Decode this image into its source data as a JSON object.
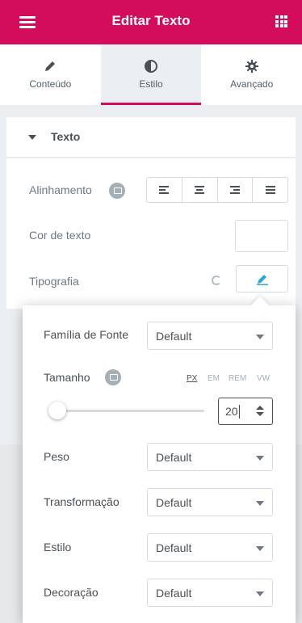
{
  "header": {
    "title": "Editar Texto",
    "menu_icon": "hamburger-icon",
    "apps_icon": "grid-icon"
  },
  "tabs": [
    {
      "label": "Conteúdo",
      "icon": "pencil-icon"
    },
    {
      "label": "Estilo",
      "icon": "half-circle-icon",
      "active": true
    },
    {
      "label": "Avançado",
      "icon": "gear-icon"
    }
  ],
  "section": {
    "title": "Texto"
  },
  "controls": {
    "alignment_label": "Alinhamento",
    "color_label": "Cor de texto",
    "typography_label": "Tipografia"
  },
  "typography": {
    "font_family_label": "Família de Fonte",
    "font_family_value": "Default",
    "size_label": "Tamanho",
    "units": [
      "PX",
      "EM",
      "REM",
      "VW"
    ],
    "selected_unit": "PX",
    "size_value": "20",
    "weight_label": "Peso",
    "weight_value": "Default",
    "transform_label": "Transformação",
    "transform_value": "Default",
    "style_label": "Estilo",
    "style_value": "Default",
    "decoration_label": "Decoração",
    "decoration_value": "Default"
  },
  "colors": {
    "brand": "#d30c5c",
    "text": "#495157",
    "border": "#d5dadf"
  }
}
